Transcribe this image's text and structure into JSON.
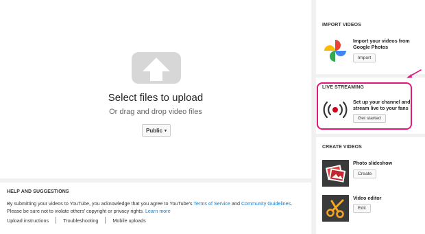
{
  "upload": {
    "title": "Select files to upload",
    "subtitle": "Or drag and drop video files",
    "privacy_label": "Public",
    "privacy_caret": "▾"
  },
  "help": {
    "title": "HELP AND SUGGESTIONS",
    "text_part1": "By submitting your videos to YouTube, you acknowledge that you agree to YouTube's ",
    "terms_link": "Terms of Service",
    "text_and": " and ",
    "guidelines_link": "Community Guidelines",
    "text_part2": ".",
    "text_line2": "Please be sure not to violate others' copyright or privacy rights. ",
    "learn_more_link": "Learn more",
    "links": [
      "Upload instructions",
      "Troubleshooting",
      "Mobile uploads"
    ]
  },
  "import_videos": {
    "title": "IMPORT VIDEOS",
    "description": "Import your videos from Google Photos",
    "button": "Import"
  },
  "live_streaming": {
    "title": "LIVE STREAMING",
    "description": "Set up your channel and stream live to your fans",
    "button": "Get started"
  },
  "create_videos": {
    "title": "CREATE VIDEOS",
    "photo_slideshow": {
      "label": "Photo slideshow",
      "button": "Create"
    },
    "video_editor": {
      "label": "Video editor",
      "button": "Edit"
    }
  },
  "colors": {
    "highlight": "#e0177c",
    "link": "#167ac6",
    "live_red": "#d0021b"
  }
}
